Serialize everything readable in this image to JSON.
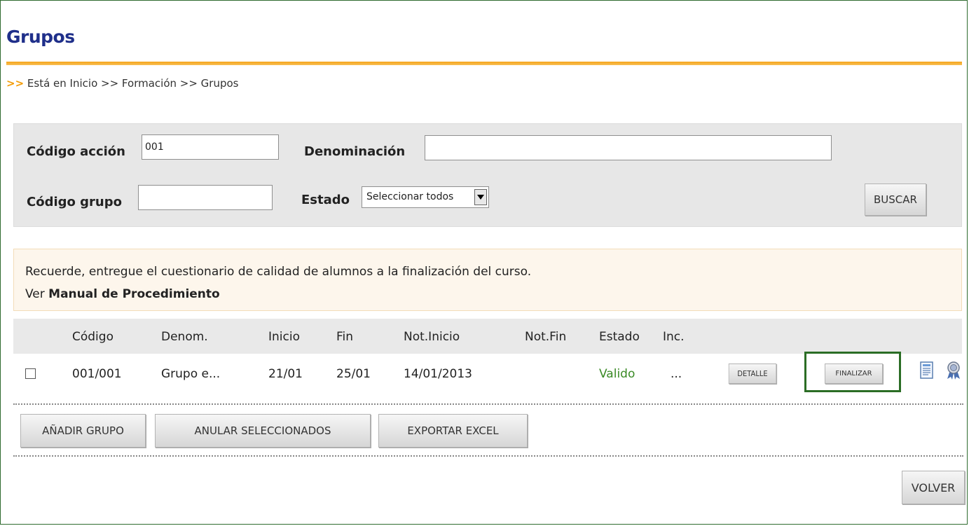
{
  "page": {
    "title": "Grupos",
    "breadcrumb": {
      "arrows": ">>",
      "text": "Está en Inicio >> Formación >> Grupos"
    }
  },
  "search": {
    "codigo_accion_label": "Código acción",
    "codigo_accion_value": "001",
    "denominacion_label": "Denominación",
    "denominacion_value": "",
    "codigo_grupo_label": "Código grupo",
    "codigo_grupo_value": "",
    "estado_label": "Estado",
    "estado_selected": "Seleccionar todos",
    "buscar_label": "BUSCAR"
  },
  "notice": {
    "line1": "Recuerde, entregue el cuestionario de calidad de alumnos a la finalización del curso.",
    "line2_prefix": "Ver",
    "line2_link": "Manual de Procedimiento"
  },
  "table": {
    "headers": [
      "Código",
      "Denom.",
      "Inicio",
      "Fin",
      "Not.Inicio",
      "Not.Fin",
      "Estado",
      "Inc."
    ],
    "rows": [
      {
        "codigo": "001/001",
        "denom": "Grupo e...",
        "inicio": "21/01",
        "fin": "25/01",
        "not_inicio": "14/01/2013",
        "not_fin": "",
        "estado": "Valido",
        "inc": "...",
        "detalle_label": "DETALLE",
        "finalizar_label": "FINALIZAR"
      }
    ],
    "estado_color": "#3a8a25"
  },
  "actions": {
    "anadir_label": "AÑADIR GRUPO",
    "anular_label": "ANULAR SELECCIONADOS",
    "exportar_label": "EXPORTAR EXCEL",
    "volver_label": "VOLVER"
  },
  "icons": {
    "row_doc": "document-icon",
    "row_award": "award-ribbon-icon"
  }
}
